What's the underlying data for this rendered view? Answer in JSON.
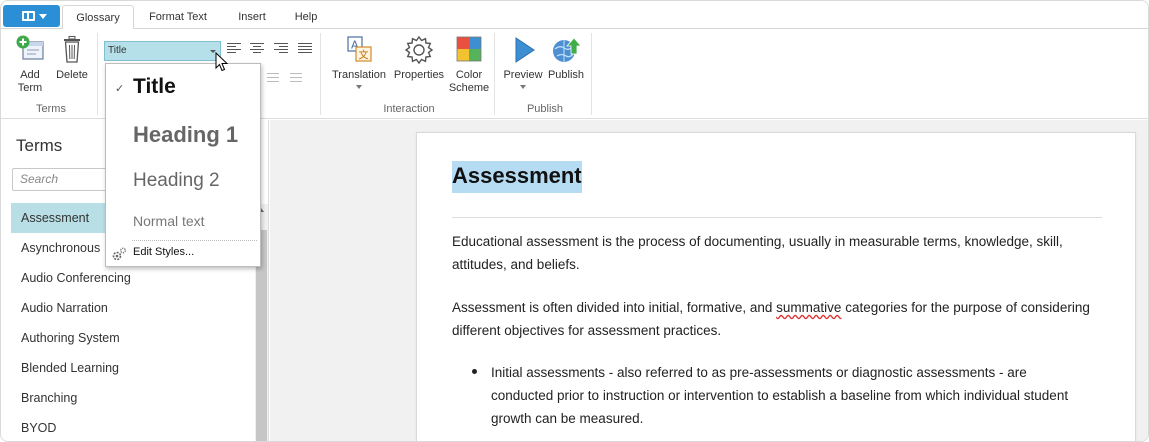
{
  "tabs": [
    "Glossary",
    "Format Text",
    "Insert",
    "Help"
  ],
  "ribbon": {
    "add_term": [
      "Add",
      "Term"
    ],
    "delete": "Delete",
    "terms_group": "Terms",
    "style_value": "Title",
    "translation": "Translation",
    "properties": "Properties",
    "color_scheme": [
      "Color",
      "Scheme"
    ],
    "interaction_group": "Interaction",
    "preview": "Preview",
    "publish": "Publish",
    "publish_group": "Publish"
  },
  "dropdown": {
    "items": [
      "Title",
      "Heading 1",
      "Heading 2",
      "Normal text"
    ],
    "checked": "Title",
    "edit_styles": "Edit Styles..."
  },
  "sidebar": {
    "title": "Terms",
    "search_placeholder": "Search",
    "terms": [
      "Assessment",
      "Asynchronous",
      "Audio Conferencing",
      "Audio Narration",
      "Authoring System",
      "Blended Learning",
      "Branching",
      "BYOD"
    ],
    "selected": "Assessment"
  },
  "document": {
    "title": "Assessment",
    "para1": "Educational assessment is the process of documenting, usually in measurable terms, knowledge, skill, attitudes, and beliefs.",
    "para2_before": "Assessment is often divided into initial, formative, and ",
    "para2_misspelled": "summative",
    "para2_after": " categories for the purpose of considering different objectives for assessment practices.",
    "bullet1": "Initial assessments - also referred to as pre-assessments or diagnostic assessments - are conducted prior to instruction or intervention to establish a baseline from which individual student growth can be measured."
  },
  "colors": {
    "accent": "#2b8fd6",
    "selected_term": "#b8dfe6",
    "title_highlight": "#b5dcf3",
    "style_select": "#b5e0ea"
  }
}
